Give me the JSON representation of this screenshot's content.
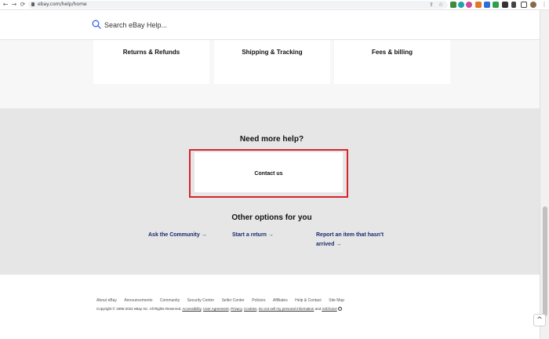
{
  "browser": {
    "back_glyph": "←",
    "forward_glyph": "→",
    "reload_glyph": "⟳",
    "url": "ebay.com/help/home",
    "share_glyph": "⇪",
    "star_glyph": "☆",
    "menu_glyph": "⋮"
  },
  "search": {
    "placeholder": "Search eBay Help..."
  },
  "cards": [
    {
      "label": "Returns & Refunds"
    },
    {
      "label": "Shipping & Tracking"
    },
    {
      "label": "Fees & billing"
    }
  ],
  "help": {
    "heading": "Need more help?",
    "contact_label": "Contact us",
    "other_heading": "Other options for you",
    "options": [
      {
        "label": "Ask the Community →"
      },
      {
        "label": "Start a return →"
      },
      {
        "line1": "Report an item that hasn't",
        "line2": "arrived →"
      }
    ]
  },
  "footer": {
    "links": [
      "About eBay",
      "Announcements",
      "Community",
      "Security Center",
      "Seller Center",
      "Policies",
      "Affiliates",
      "Help & Contact",
      "Site Map"
    ],
    "copyright_prefix": "Copyright © 1995-2022 eBay Inc. All Rights Reserved.",
    "legal_links": [
      "Accessibility",
      "User Agreement",
      "Privacy",
      "Cookies",
      "Do not sell my personal information",
      "AdChoice"
    ],
    "and_text": "and"
  },
  "back_to_top_glyph": "^",
  "colors": {
    "highlight_border": "#d6262b",
    "link": "#1a2a6c",
    "help_bg": "#e6e6e7",
    "search_icon": "#3665f3"
  }
}
